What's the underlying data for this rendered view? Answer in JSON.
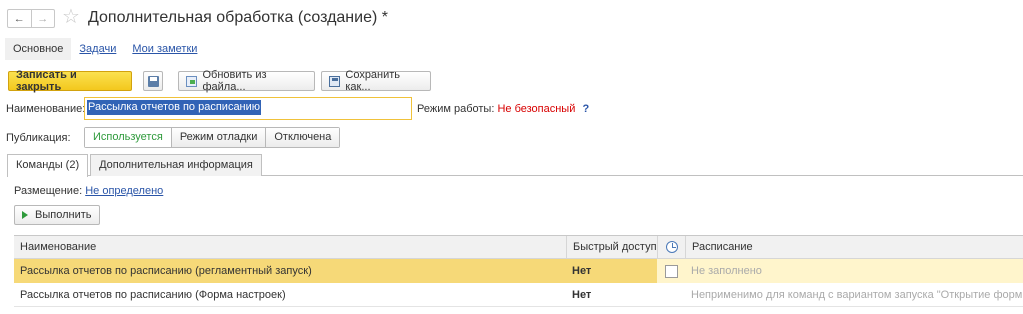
{
  "window": {
    "back_icon": "back-arrow-icon",
    "forward_icon": "forward-arrow-icon",
    "title": "Дополнительная обработка (создание) *"
  },
  "top_nav": {
    "tabs": [
      {
        "label": "Основное",
        "active": true
      },
      {
        "label": "Задачи",
        "active": false
      },
      {
        "label": "Мои заметки",
        "active": false
      }
    ]
  },
  "toolbar": {
    "save_close_label": "Записать и закрыть",
    "update_label": "Обновить из файла...",
    "save_as_label": "Сохранить как..."
  },
  "form": {
    "name_label": "Наименование:",
    "name_value": "Рассылка отчетов по расписанию",
    "mode_label": "Режим работы:",
    "mode_value": "Не безопасный",
    "mode_help": "?",
    "publication_label": "Публикация:",
    "publication_options": [
      "Используется",
      "Режим отладки",
      "Отключена"
    ],
    "publication_selected": "Используется"
  },
  "form_tabs": [
    {
      "label": "Команды (2)",
      "active": true
    },
    {
      "label": "Дополнительная информация",
      "active": false
    }
  ],
  "commands": {
    "placement_label": "Размещение:",
    "placement_value": "Не определено",
    "run_label": "Выполнить",
    "columns": [
      "Наименование",
      "Быстрый доступ",
      "",
      "Расписание"
    ],
    "rows": [
      {
        "name": "Рассылка отчетов по расписанию (регламентный запуск)",
        "quick_access": "Нет",
        "schedule": "Не заполнено",
        "selected": true
      },
      {
        "name": "Рассылка отчетов по расписанию (Форма настроек)",
        "quick_access": "Нет",
        "schedule": "Неприменимо для команд с вариантом запуска \"Открытие формы\"",
        "selected": false
      }
    ]
  },
  "colors": {
    "primary_button": "#f3c81d",
    "selection": "#3163b6",
    "row_highlight": "#fbeba9",
    "unsafe_mode": "#d80000",
    "link": "#2a55a8",
    "active_option": "#2e9a3b"
  }
}
